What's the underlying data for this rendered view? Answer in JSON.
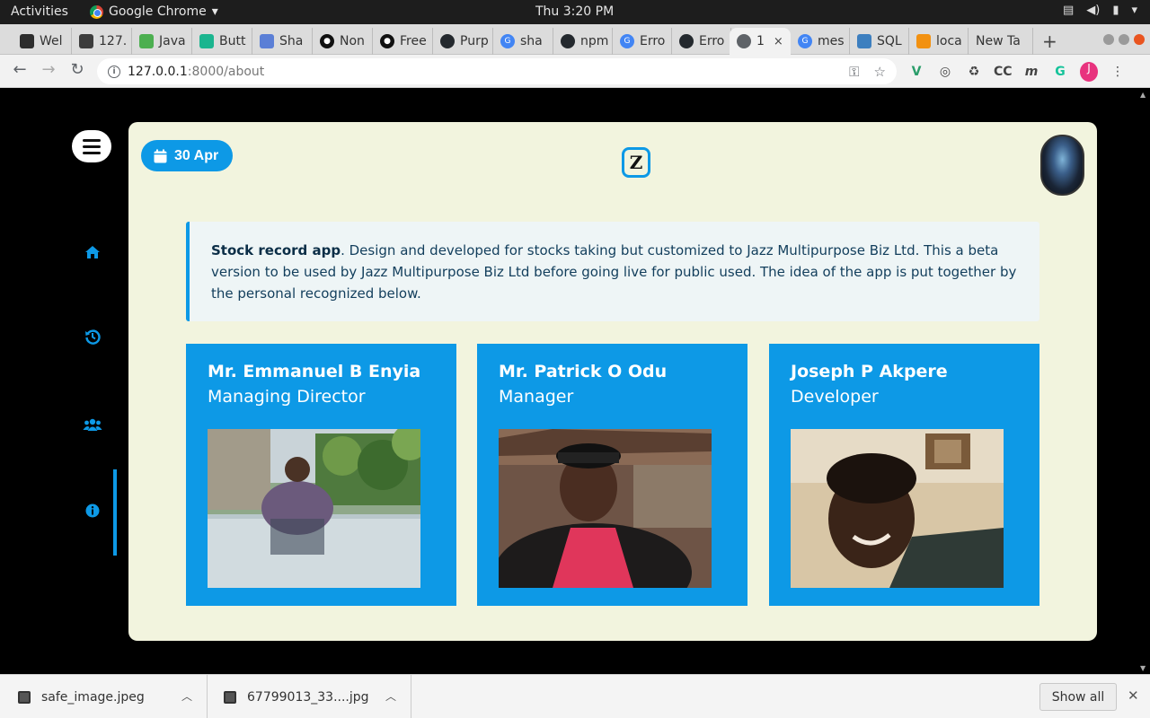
{
  "system_bar": {
    "activities": "Activities",
    "app_name": "Google Chrome",
    "clock": "Thu  3:20 PM"
  },
  "tabs": [
    {
      "label": "Wel",
      "favicon_color": "#2d2d2d"
    },
    {
      "label": "127.",
      "favicon_color": "#3c3c3c"
    },
    {
      "label": "Java",
      "favicon_color": "#4caf50"
    },
    {
      "label": "Butt",
      "favicon_color": "#1bb58f"
    },
    {
      "label": "Sha",
      "favicon_color": "#5b7fd6"
    },
    {
      "label": "Non",
      "favicon_color": "#111111"
    },
    {
      "label": "Free",
      "favicon_color": "#111111"
    },
    {
      "label": "Purp",
      "favicon_color": "#24292e"
    },
    {
      "label": "sha",
      "favicon_color": "#4285f4"
    },
    {
      "label": "npm",
      "favicon_color": "#24292e"
    },
    {
      "label": "Erro",
      "favicon_color": "#4285f4"
    },
    {
      "label": "Erro",
      "favicon_color": "#24292e"
    },
    {
      "label": "1",
      "favicon_color": "#5f6368"
    },
    {
      "label": "mes",
      "favicon_color": "#4285f4"
    },
    {
      "label": "SQL",
      "favicon_color": "#3d7fbf"
    },
    {
      "label": "loca",
      "favicon_color": "#f29111"
    },
    {
      "label": "New Ta",
      "favicon_color": ""
    }
  ],
  "tab_close_glyph": "×",
  "address_bar": {
    "host": "127.0.0.1",
    "path": ":8000/about"
  },
  "profile_initial": "J",
  "page": {
    "date_badge": "30 Apr",
    "logo_text": "Z",
    "sidebar": [
      "home-icon",
      "history-icon",
      "users-icon",
      "info-icon"
    ],
    "intro": {
      "title": "Stock record app",
      "body": ". Design and developed for stocks taking but customized to Jazz Multipurpose Biz Ltd. This a beta version to be used by Jazz Multipurpose Biz Ltd before going live for public used. The idea of the app is put together by the personal recognized below."
    },
    "team": [
      {
        "name": "Mr. Emmanuel B Enyia",
        "role": "Managing Director"
      },
      {
        "name": "Mr. Patrick O Odu",
        "role": "Manager"
      },
      {
        "name": "Joseph P Akpere",
        "role": "Developer"
      }
    ]
  },
  "downloads": [
    {
      "file": "safe_image.jpeg"
    },
    {
      "file": "67799013_33....jpg"
    }
  ],
  "show_all_label": "Show all",
  "colors": {
    "accent": "#0d99e6",
    "card_background": "#f2f4de",
    "intro_background": "#eef5f6"
  }
}
